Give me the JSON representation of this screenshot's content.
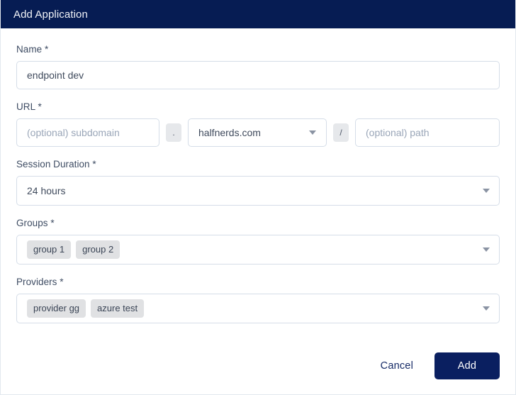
{
  "header": {
    "title": "Add Application",
    "background_color": "#061c53"
  },
  "form": {
    "name": {
      "label": "Name *",
      "value": "endpoint dev",
      "placeholder": ""
    },
    "url": {
      "label": "URL *",
      "subdomain_placeholder": "(optional) subdomain",
      "subdomain_value": "",
      "dot_separator": ".",
      "domain_value": "halfnerds.com",
      "slash_separator": "/",
      "path_placeholder": "(optional) path",
      "path_value": ""
    },
    "session_duration": {
      "label": "Session Duration *",
      "value": "24 hours"
    },
    "groups": {
      "label": "Groups *",
      "chips": [
        "group 1",
        "group 2"
      ]
    },
    "providers": {
      "label": "Providers *",
      "chips": [
        "provider gg",
        "azure test"
      ]
    }
  },
  "footer": {
    "cancel_label": "Cancel",
    "add_label": "Add",
    "add_button_color": "#0a1f60"
  },
  "icons": {
    "caret": "chevron-down-icon"
  }
}
